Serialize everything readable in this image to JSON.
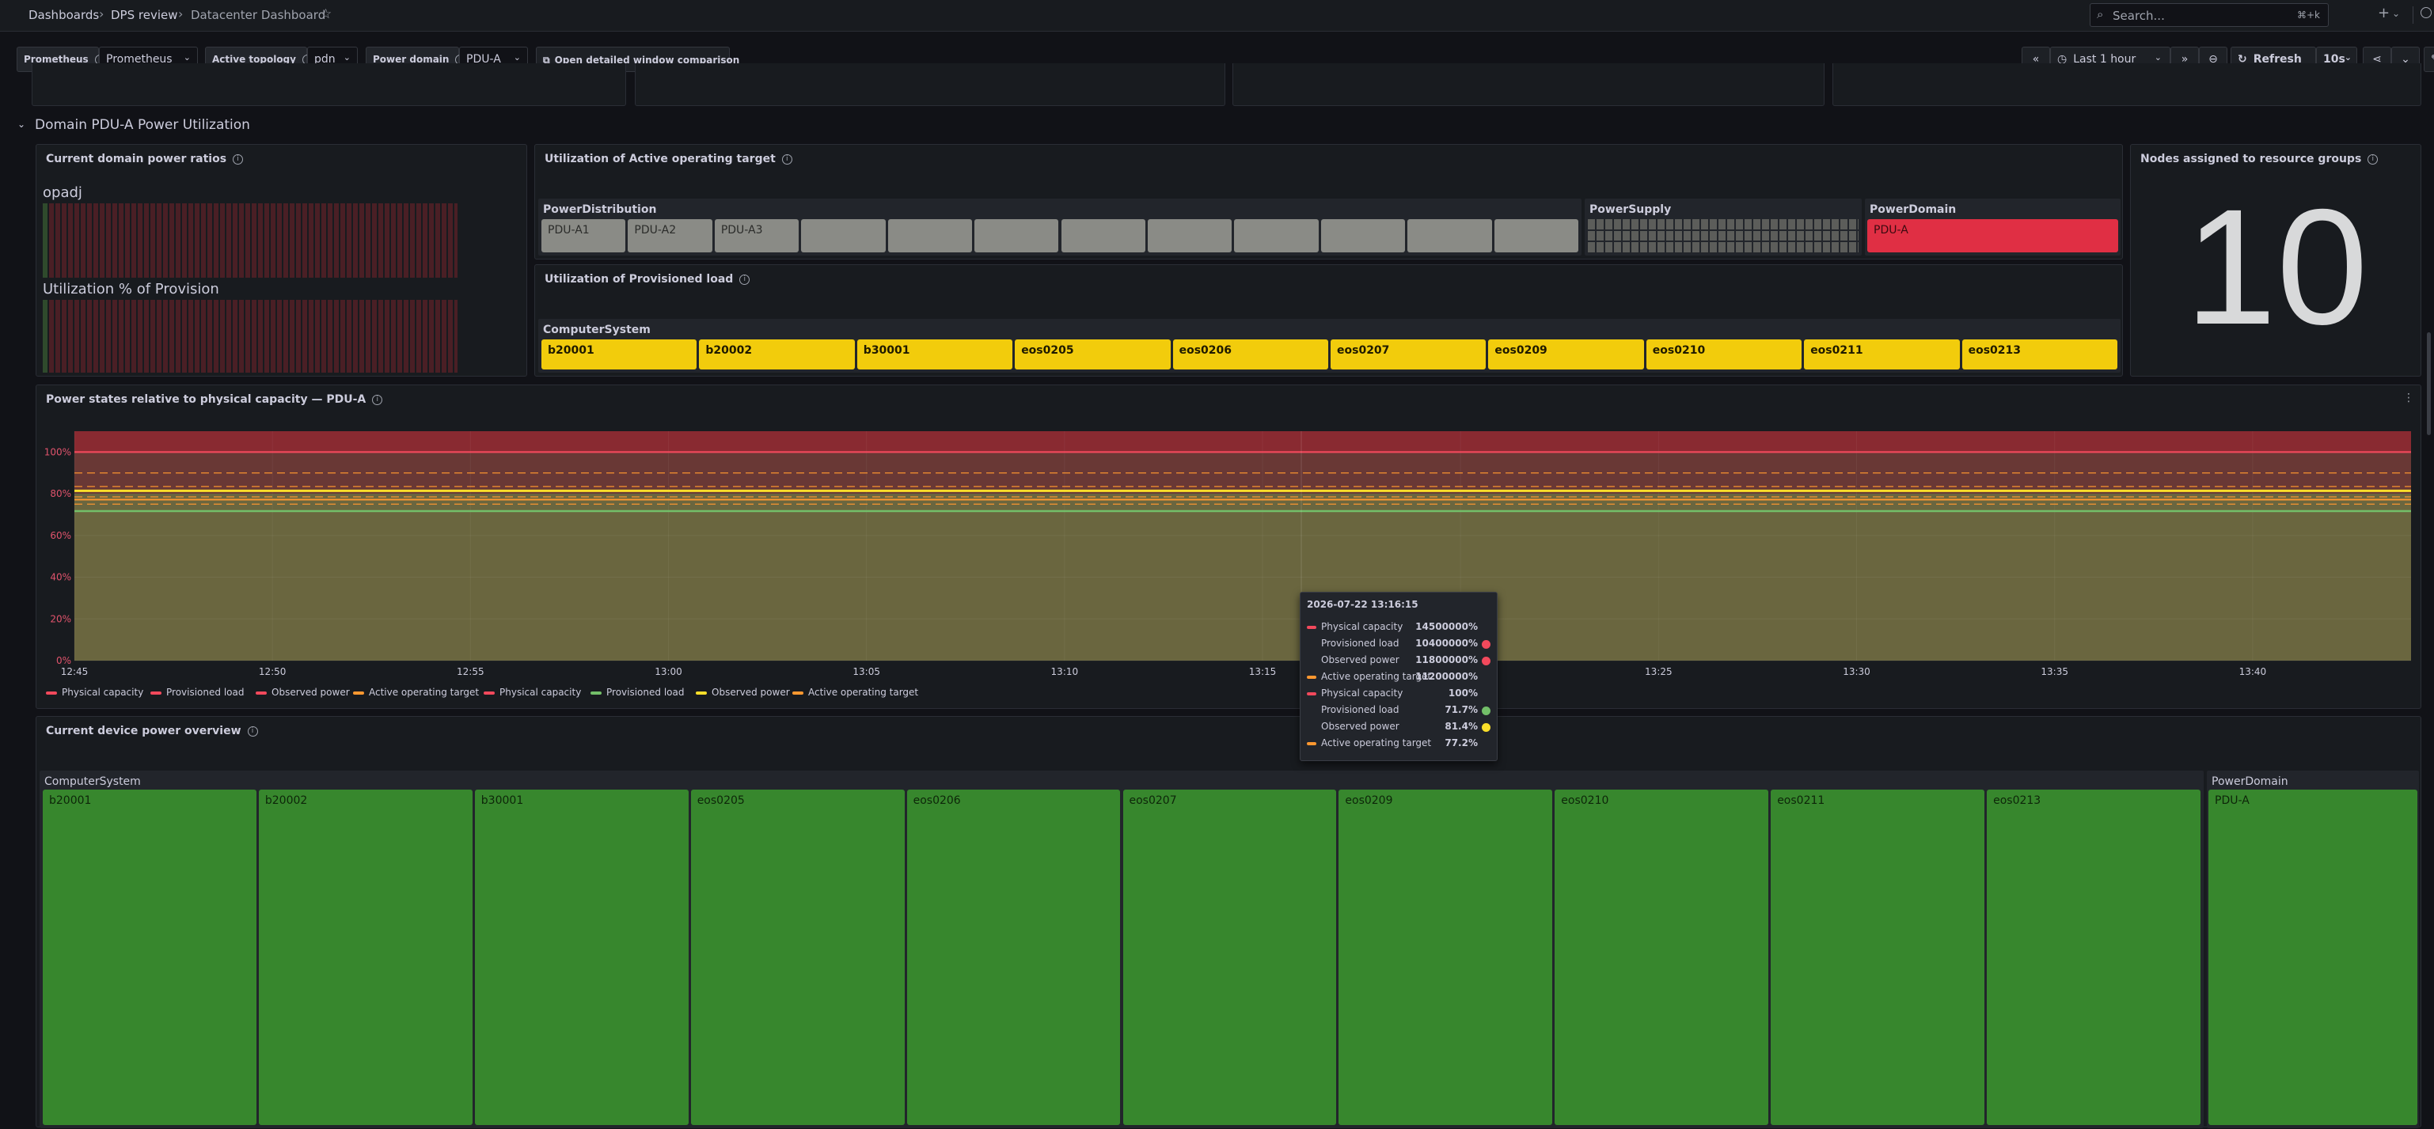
{
  "breadcrumb": [
    "Dashboards",
    "DPS review",
    "Datacenter Dashboard"
  ],
  "search": {
    "placeholder": "Search...",
    "shortcut": "⌘+k"
  },
  "variables": [
    {
      "label": "Prometheus",
      "value": "Prometheus"
    },
    {
      "label": "Active topology",
      "value": "pdn"
    },
    {
      "label": "Power domain",
      "value": "PDU-A"
    }
  ],
  "compare_button": "Open detailed window comparison",
  "time": {
    "range": "Last 1 hour",
    "refresh_label": "Refresh",
    "refresh_interval": "10s"
  },
  "row_title": "Domain PDU-A Power Utilization",
  "panels": {
    "ratios": {
      "title": "Current domain power ratios",
      "label1": "opadj",
      "label2": "Utilization % of Provision"
    },
    "active_target": {
      "title": "Utilization of Active operating target",
      "groups": {
        "distribution": {
          "name": "PowerDistribution",
          "items": [
            "PDU-A1",
            "PDU-A2",
            "PDU-A3",
            "",
            "",
            "",
            "",
            "",
            "",
            "",
            "",
            ""
          ]
        },
        "supply": {
          "name": "PowerSupply"
        },
        "domain": {
          "name": "PowerDomain",
          "items": [
            "PDU-A"
          ]
        }
      }
    },
    "provisioned": {
      "title": "Utilization of Provisioned load",
      "group": "ComputerSystem",
      "items": [
        "b20001",
        "b20002",
        "b30001",
        "eos0205",
        "eos0206",
        "eos0207",
        "eos0209",
        "eos0210",
        "eos0211",
        "eos0213"
      ]
    },
    "nodes": {
      "title": "Nodes assigned to resource groups",
      "value": "10"
    },
    "power_states": {
      "title": "Power states relative to physical capacity — PDU-A"
    },
    "device_overview": {
      "title": "Current device power overview",
      "group1": "ComputerSystem",
      "group2": "PowerDomain",
      "items": [
        "b20001",
        "b20002",
        "b30001",
        "eos0205",
        "eos0206",
        "eos0207",
        "eos0209",
        "eos0210",
        "eos0211",
        "eos0213"
      ],
      "domain_items": [
        "PDU-A"
      ]
    }
  },
  "chart_data": {
    "type": "area",
    "x": [
      "12:45",
      "12:50",
      "12:55",
      "13:00",
      "13:05",
      "13:10",
      "13:15",
      "13:20",
      "13:25",
      "13:30",
      "13:35",
      "13:40"
    ],
    "yticks": [
      "0%",
      "20%",
      "40%",
      "60%",
      "80%",
      "100%"
    ],
    "ylim": [
      0,
      110
    ],
    "series": [
      {
        "name": "Physical capacity",
        "color": "#f2495c",
        "value": 100
      },
      {
        "name": "Provisioned load",
        "color": "#f2495c",
        "value": 71.7
      },
      {
        "name": "Observed power",
        "color": "#f2495c",
        "value": 81.4
      },
      {
        "name": "Active operating target",
        "color": "#ff9830",
        "value": 77.2
      },
      {
        "name": "Physical capacity",
        "color": "#f2495c",
        "value": 100
      },
      {
        "name": "Provisioned load",
        "color": "#73bf69",
        "value": 71.7
      },
      {
        "name": "Observed power",
        "color": "#fade2a",
        "value": 81.4
      },
      {
        "name": "Active operating target",
        "color": "#ff9830",
        "value": 77.2
      }
    ],
    "thresholds": [
      {
        "from": 100,
        "to": 110,
        "color": "#8f2b33"
      },
      {
        "from": 80,
        "to": 100,
        "color": "#6e3a37"
      },
      {
        "from": 0,
        "to": 80,
        "color": "#6f6a41"
      }
    ],
    "legend": "bottom"
  },
  "tooltip": {
    "time": "2026-07-22 13:16:15",
    "rows": [
      {
        "name": "Physical capacity",
        "value": "14500000%",
        "marker": "#f2495c",
        "dot": ""
      },
      {
        "name": "Provisioned load",
        "value": "10400000%",
        "marker": "",
        "dot": "#f2495c"
      },
      {
        "name": "Observed power",
        "value": "11800000%",
        "marker": "",
        "dot": "#f2495c"
      },
      {
        "name": "Active operating target",
        "value": "11200000%",
        "marker": "#ff9830",
        "dot": ""
      },
      {
        "name": "Physical capacity",
        "value": "100%",
        "marker": "#f2495c",
        "dot": ""
      },
      {
        "name": "Provisioned load",
        "value": "71.7%",
        "marker": "",
        "dot": "#73bf69"
      },
      {
        "name": "Observed power",
        "value": "81.4%",
        "marker": "",
        "dot": "#fade2a"
      },
      {
        "name": "Active operating target",
        "value": "77.2%",
        "marker": "#ff9830",
        "dot": ""
      }
    ]
  }
}
